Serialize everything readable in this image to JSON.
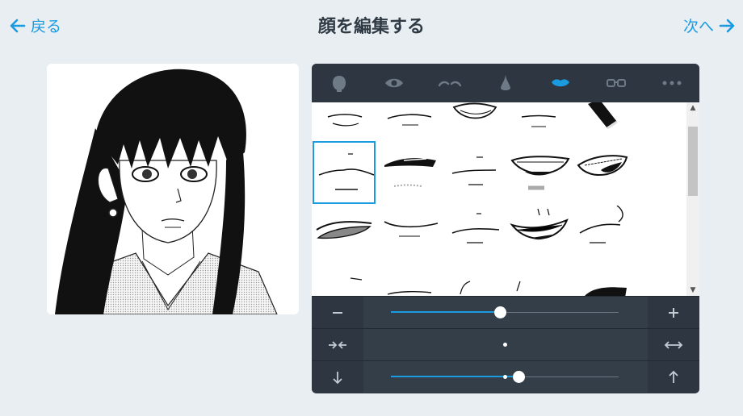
{
  "header": {
    "back_label": "戻る",
    "title": "顔を編集する",
    "next_label": "次へ"
  },
  "categories": [
    {
      "icon": "face-outline-icon"
    },
    {
      "icon": "eye-icon"
    },
    {
      "icon": "eyebrows-icon"
    },
    {
      "icon": "nose-icon"
    },
    {
      "icon": "mouth-icon",
      "active": true
    },
    {
      "icon": "glasses-icon"
    },
    {
      "icon": "more-icon"
    }
  ],
  "controls": {
    "size": {
      "left_icon": "minus-icon",
      "right_icon": "plus-icon",
      "level": 0.48
    },
    "width": {
      "left_icon": "narrow-icon",
      "right_icon": "widen-icon",
      "level": 0.5
    },
    "position": {
      "left_icon": "arrow-down-icon",
      "right_icon": "arrow-up-icon",
      "level": 0.56,
      "default_level": 0.5
    }
  },
  "colors": {
    "accent": "#1a9be0",
    "panel": "#2d3641",
    "background": "#e9eef2"
  }
}
